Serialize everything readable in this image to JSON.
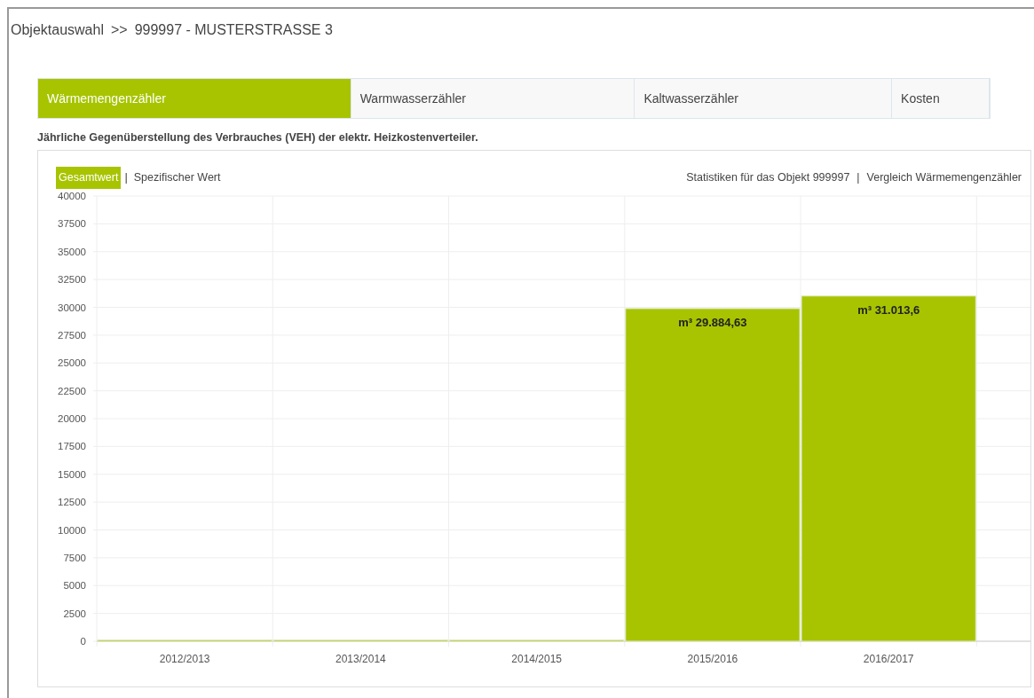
{
  "breadcrumb": {
    "root": "Objektauswahl",
    "separator": ">>",
    "current": "999997 - MUSTERSTRASSE 3"
  },
  "tabs": [
    {
      "label": "Wärmemengenzähler",
      "selected": true
    },
    {
      "label": "Warmwasserzähler",
      "selected": false
    },
    {
      "label": "Kaltwasserzähler",
      "selected": false
    },
    {
      "label": "Kosten",
      "selected": false
    }
  ],
  "subtitle": "Jährliche Gegenüberstellung des Verbrauches (VEH) der elektr. Heizkostenverteiler.",
  "value_toggle": [
    {
      "label": "Gesamtwert",
      "selected": true
    },
    {
      "label": "Spezifischer Wert",
      "selected": false
    }
  ],
  "toggle_separator": "|",
  "links": [
    {
      "label": "Statistiken für das Objekt 999997"
    },
    {
      "label": "Vergleich Wärmemengenzähler"
    }
  ],
  "link_separator": "|",
  "chart": {
    "chart_data": {
      "type": "bar",
      "categories": [
        "2012/2013",
        "2013/2014",
        "2014/2015",
        "2015/2016",
        "2016/2017"
      ],
      "values": [
        0,
        0,
        0,
        29885,
        31014
      ],
      "grid": true,
      "ylim": [
        0,
        40000
      ],
      "yticks": [
        0,
        2500,
        5000,
        7500,
        10000,
        12500,
        15000,
        17500,
        20000,
        22500,
        25000,
        27500,
        30000,
        32500,
        35000,
        37500,
        40000
      ],
      "value_labels": [
        null,
        null,
        null,
        "m³ 29.884,63",
        "m³ 31.013,6"
      ]
    }
  }
}
